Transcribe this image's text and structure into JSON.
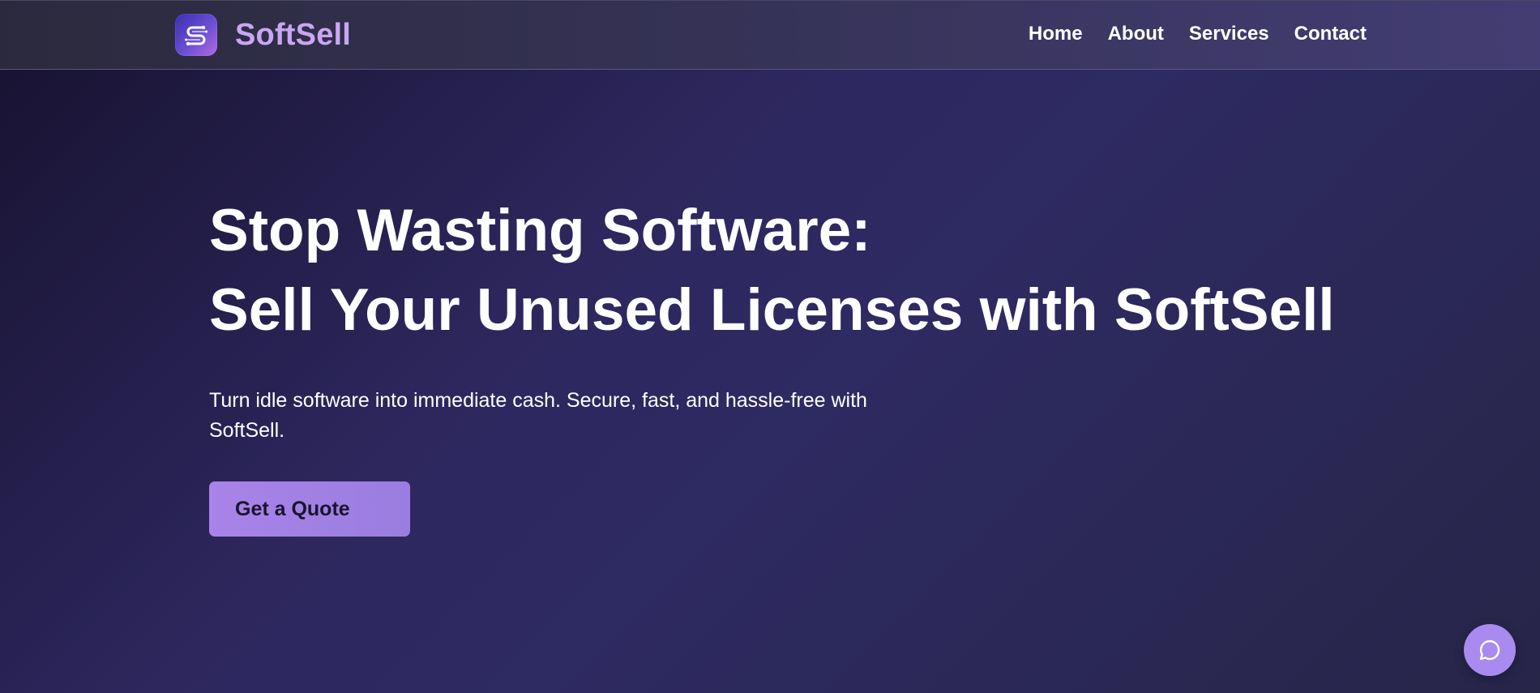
{
  "brand": {
    "name": "SoftSell",
    "logo_icon": "softsell-logo-icon",
    "accent_color": "#c9a6f2"
  },
  "nav": {
    "items": [
      {
        "label": "Home"
      },
      {
        "label": "About"
      },
      {
        "label": "Services"
      },
      {
        "label": "Contact"
      }
    ]
  },
  "hero": {
    "title_line1": "Stop Wasting Software:",
    "title_line2": "Sell Your Unused Licenses with SoftSell",
    "subtitle": "Turn idle software into immediate cash. Secure, fast, and hassle-free with SoftSell.",
    "cta_label": "Get a Quote",
    "cta_color": "#a983e8"
  },
  "chat": {
    "icon": "chat-bubble-icon",
    "color": "#a98bf0"
  }
}
